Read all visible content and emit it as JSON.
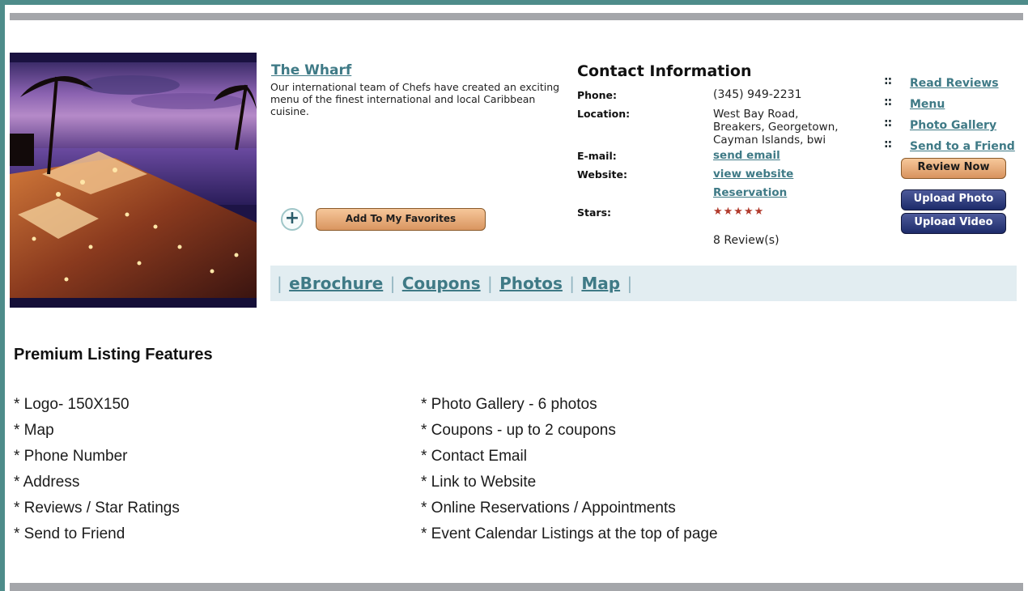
{
  "listing": {
    "name": "The Wharf",
    "description": "Our international team of Chefs have created an exciting menu of the finest international and local Caribbean cuisine.",
    "favorites_label": "Add To My Favorites",
    "plus_icon": "plus-icon"
  },
  "contact": {
    "title": "Contact Information",
    "phone_label": "Phone:",
    "phone": "(345) 949-2231",
    "location_label": "Location:",
    "location_lines": [
      "West Bay Road,",
      "Breakers, Georgetown,",
      "Cayman Islands, bwi"
    ],
    "email_label": "E-mail:",
    "email_link": "send email",
    "website_label": "Website:",
    "website_link": "view website",
    "reservation_link": "Reservation",
    "stars_label": "Stars:",
    "stars": "★★★★★",
    "reviews": "8 Review(s)"
  },
  "side_links": [
    "Read Reviews",
    "Menu",
    "Photo Gallery",
    "Send to a Friend"
  ],
  "buttons": {
    "review_now": "Review Now",
    "upload_photo": "Upload Photo",
    "upload_video": "Upload Video"
  },
  "nav": {
    "separator": "|",
    "links": [
      "eBrochure",
      "Coupons",
      "Photos",
      "Map"
    ]
  },
  "features": {
    "title": "Premium Listing Features",
    "left": [
      "* Logo- 150X150",
      "* Map",
      "* Phone Number",
      "* Address",
      "* Reviews / Star Ratings",
      "* Send to Friend"
    ],
    "right": [
      "* Photo Gallery - 6 photos",
      "* Coupons - up to 2 coupons",
      "* Contact Email",
      "* Link to Website",
      "* Online Reservations / Appointments",
      "* Event Calendar Listings at the top of page"
    ]
  },
  "colors": {
    "frame": "#4e8c8a",
    "link": "#3f7a86",
    "orange_button": "#e9a872",
    "blue_button": "#2d3a78",
    "nav_bg": "#e2edf1",
    "star": "#b23a2c"
  }
}
